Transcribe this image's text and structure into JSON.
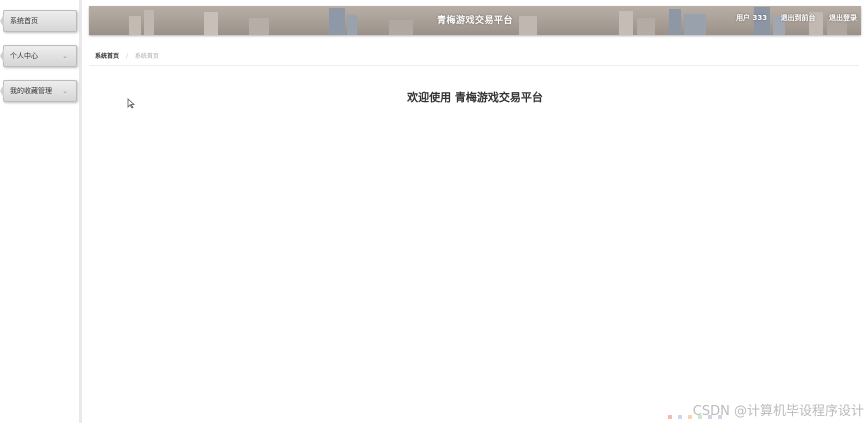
{
  "sidebar": {
    "items": [
      {
        "label": "系统首页"
      },
      {
        "label": "个人中心"
      },
      {
        "label": "我的收藏管理"
      }
    ]
  },
  "header": {
    "title": "青梅游戏交易平台",
    "user": "用户 333",
    "to_frontend": "退出到前台",
    "logout": "退出登录"
  },
  "breadcrumb": {
    "home": "系统首页",
    "current": "系统首页"
  },
  "main": {
    "welcome": "欢迎使用 青梅游戏交易平台"
  },
  "watermark": {
    "text": "CSDN @计算机毕设程序设计"
  }
}
